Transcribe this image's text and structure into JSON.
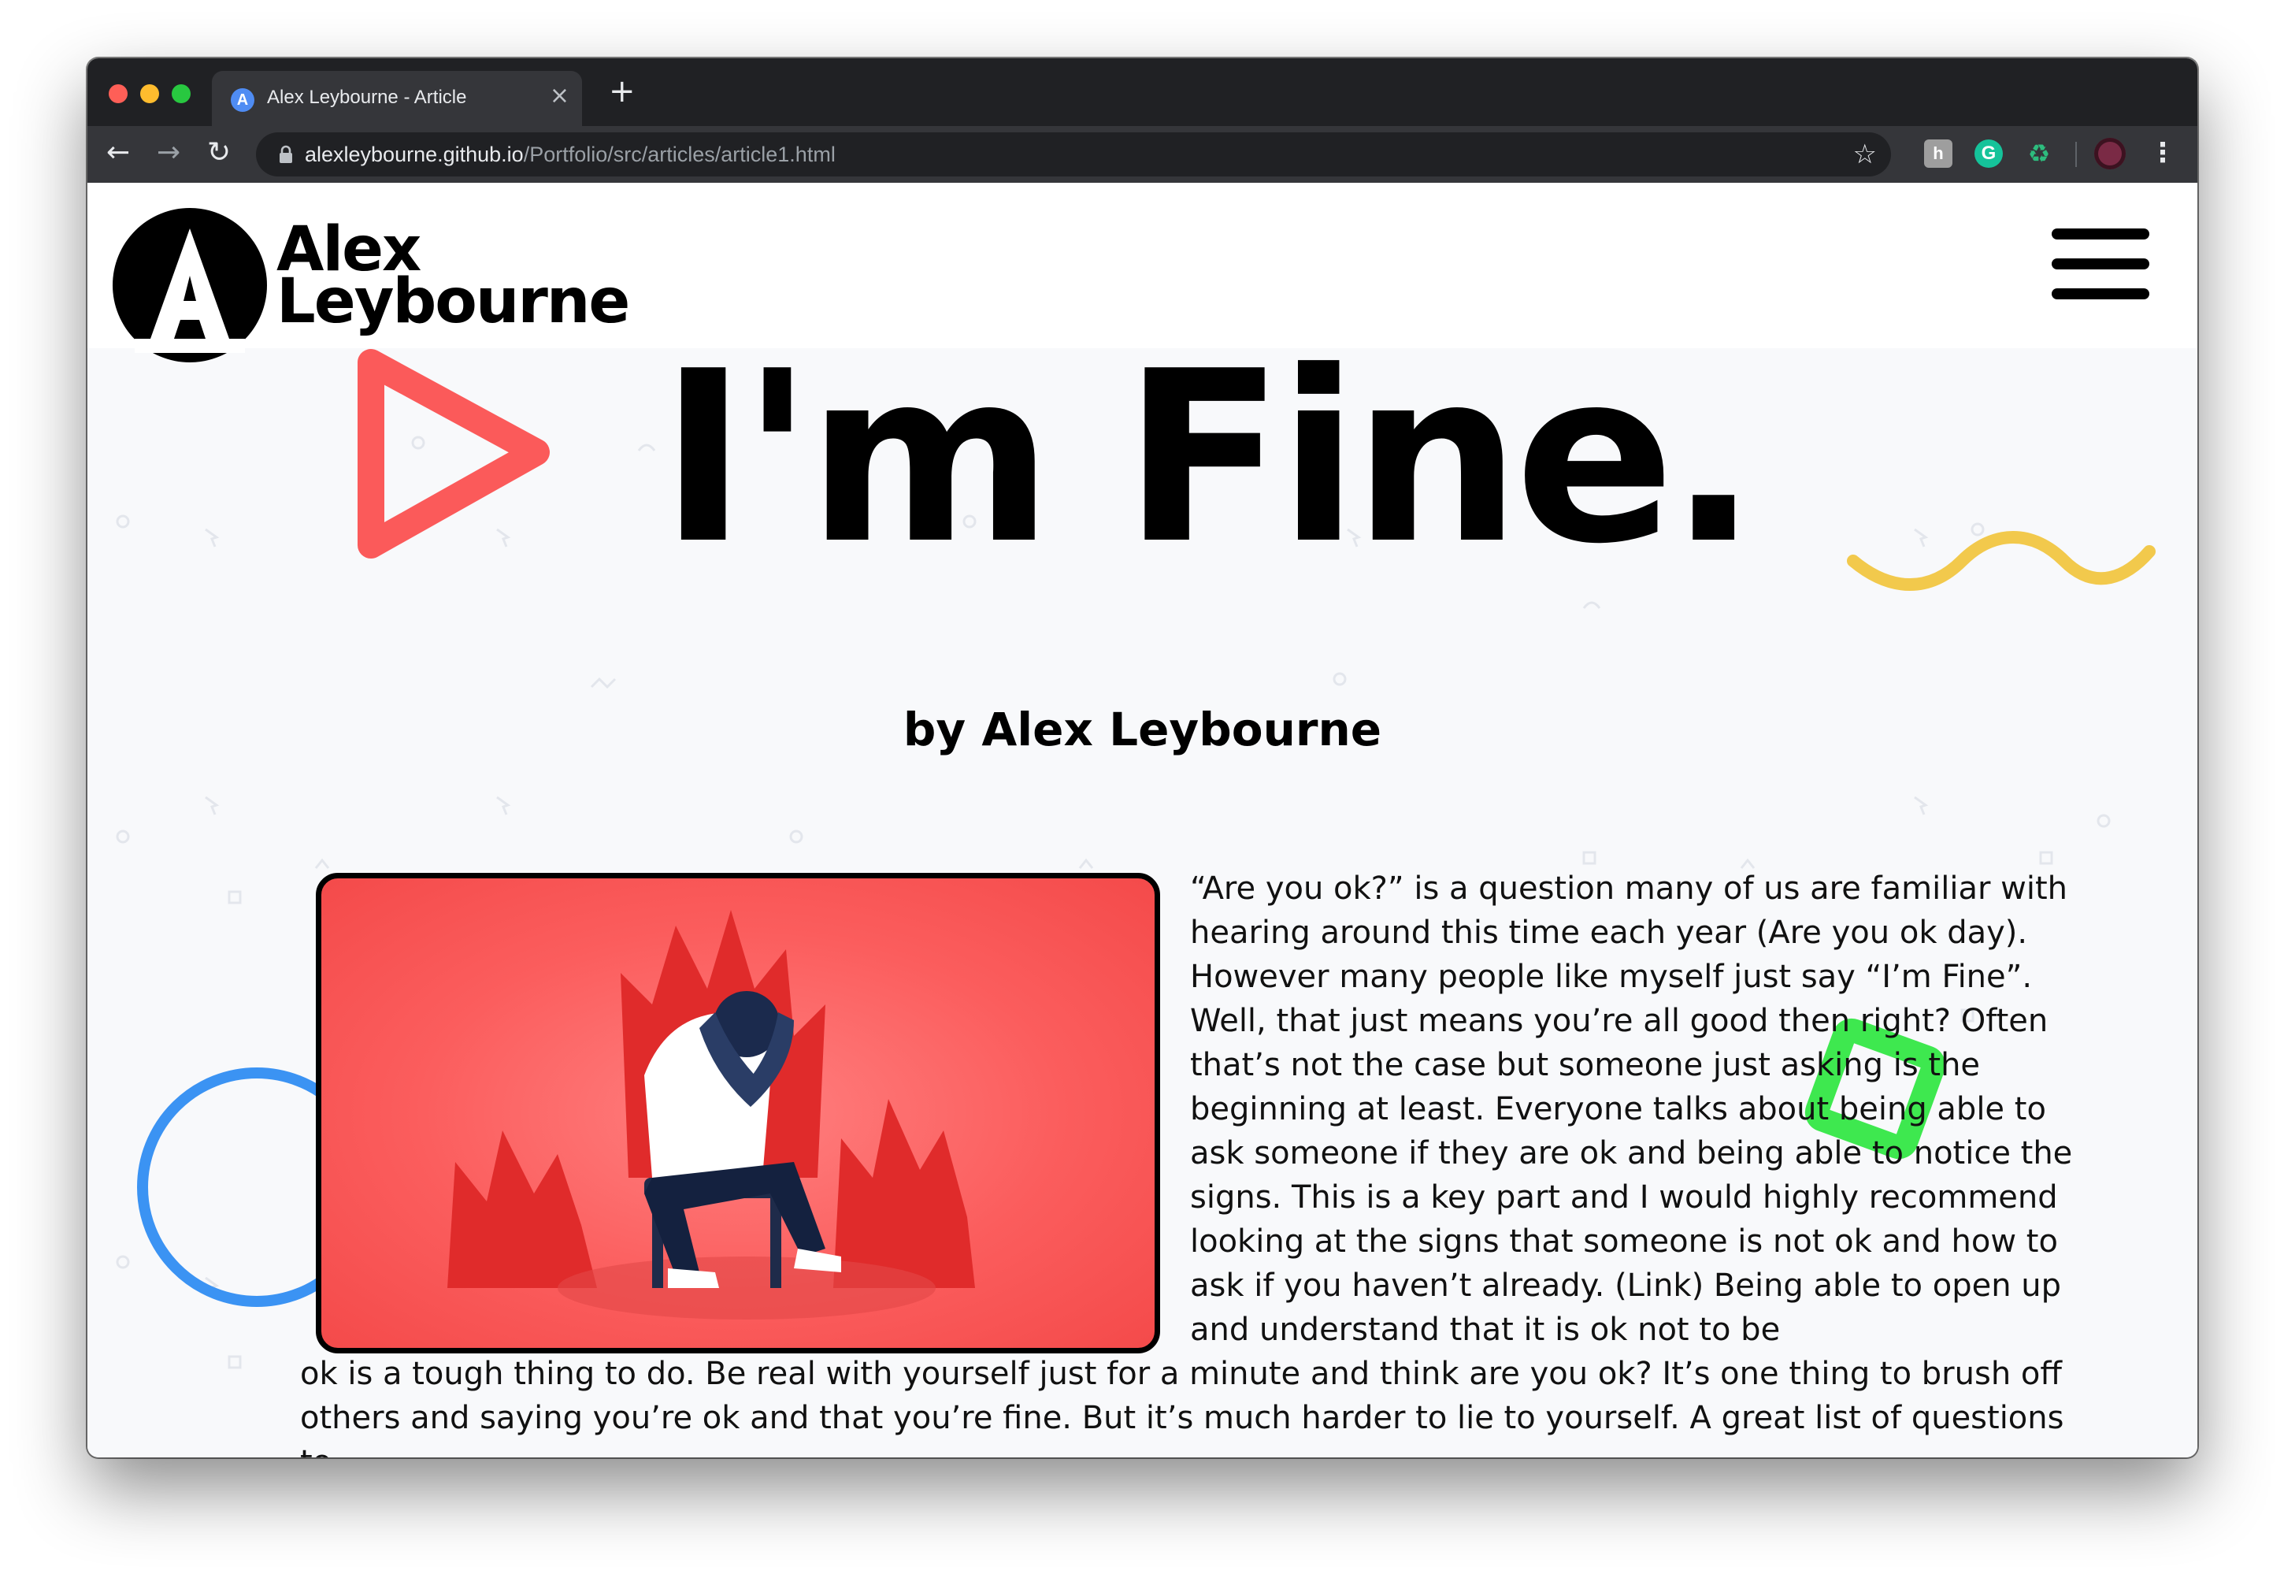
{
  "browser": {
    "tab_title": "Alex Leybourne - Article",
    "tab_favicon_letter": "A",
    "tab_close": "×",
    "new_tab": "+",
    "url_host": "alexleybourne.github.io",
    "url_path": "/Portfolio/src/articles/article1.html",
    "icons": [
      "back-arrow-icon",
      "forward-arrow-icon",
      "reload-icon",
      "lock-icon",
      "star-icon",
      "extension-icon",
      "grammarly-icon",
      "recycle-icon",
      "profile-avatar",
      "menu-dots-icon"
    ]
  },
  "site": {
    "logo_line1": "Alex",
    "logo_line2": "Leybourne",
    "menu_icon": "hamburger-menu-icon"
  },
  "article": {
    "title": "I'm Fine.",
    "byline": "by Alex Leybourne",
    "paragraph_side": "“Are you ok?” is a question many of us are familiar with hearing around this time each year (Are you ok day). However many people like myself just say “I’m Fine”. Well, that just means you’re all good then right? Often that’s not the case but someone just asking is the beginning at least. Everyone talks about being able to ask someone if they are ok and being able to notice the signs. This is a key part and I would highly recommend looking at the signs that someone is not ok and how to ask if you haven’t already. (Link) Being able to open up and understand that it is ok not to be",
    "paragraph_full": "ok is a tough thing to do. Be real with yourself just for a minute and think are you ok? It’s one thing to brush off others and saying you’re ok and that you’re fine. But it’s much harder to lie to yourself. A great list of questions to"
  },
  "colors": {
    "chrome_dark": "#202124",
    "chrome_toolbar": "#35363a",
    "accent_red": "#fb5a5a",
    "accent_yellow": "#f2c94c",
    "accent_green": "#3ee84f",
    "accent_blue": "#3b93f3",
    "page_bg": "#f8f9fb"
  }
}
